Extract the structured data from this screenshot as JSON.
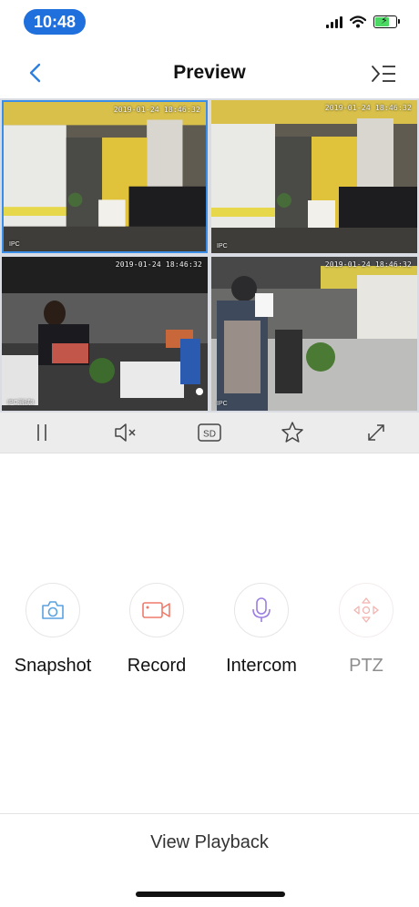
{
  "status_bar": {
    "time": "10:48",
    "battery_level": 0.75,
    "charging": true
  },
  "nav": {
    "title": "Preview",
    "back_icon": "chevron-left-icon",
    "menu_icon": "list-menu-icon"
  },
  "video_tiles": [
    {
      "timestamp": "2019-01-24 18:46:32",
      "name": "IPC",
      "selected": true
    },
    {
      "timestamp": "2019-01-24 18:46:32",
      "name": "IPC",
      "selected": false
    },
    {
      "timestamp": "2019-01-24 18:46:32",
      "name": "IPC测试3",
      "selected": false
    },
    {
      "timestamp": "2019-01-24 18:46:32",
      "name": "IPC",
      "selected": false
    }
  ],
  "toolbar": {
    "pause_icon": "pause-icon",
    "mute_icon": "speaker-mute-icon",
    "quality_label": "SD",
    "favorite_icon": "star-icon",
    "fullscreen_icon": "expand-icon"
  },
  "actions": {
    "snapshot": "Snapshot",
    "record": "Record",
    "intercom": "Intercom",
    "ptz": "PTZ"
  },
  "bottom": {
    "view_playback": "View Playback"
  },
  "colors": {
    "accent": "#1f6fdc",
    "selection_border": "#3a8ee8",
    "record_red": "#f07a6a",
    "intercom_purple": "#9b7ee0",
    "camera_blue": "#5aa2e0"
  }
}
